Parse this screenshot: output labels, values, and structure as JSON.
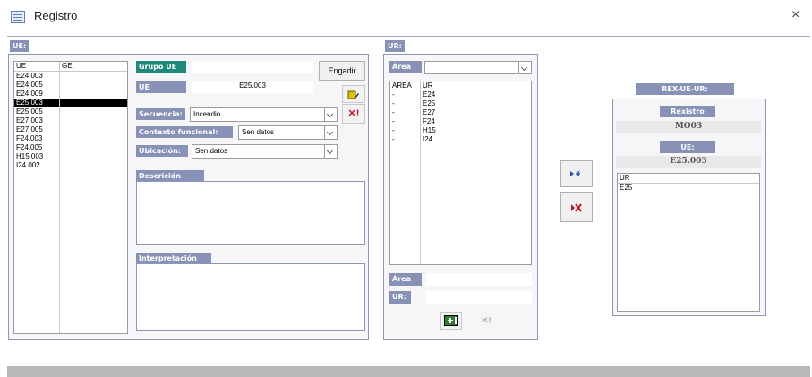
{
  "window": {
    "title": "Registro",
    "close": "×"
  },
  "ue_panel": {
    "header": "UE:",
    "columns": [
      "UE",
      "GE"
    ],
    "rows": [
      "E24.003",
      "E24.005",
      "E24.009",
      "E25.003",
      "E25.005",
      "E27.003",
      "E27.005",
      "F24.003",
      "F24.005",
      "H15.003",
      "I24.002"
    ],
    "selected_index": 3
  },
  "form": {
    "grupo_ue_label": "Grupo UE",
    "grupo_ue_value": "",
    "ue_label": "UE",
    "ue_value": "E25.003",
    "engadir_label": "Engadir",
    "secuencia_label": "Secuencia:",
    "secuencia_value": "Incendio",
    "contexto_label": "Contexto funcional:",
    "contexto_value": "Sen datos",
    "ubicacion_label": "Ubicación:",
    "ubicacion_value": "Sen datos",
    "descricion_label": "Descrición",
    "interpretacion_label": "Interpretación"
  },
  "ur_panel": {
    "header": "UR:",
    "area_label": "Área",
    "area_value": "",
    "columns": [
      "AREA",
      "UR"
    ],
    "rows": [
      [
        "-",
        "E24"
      ],
      [
        "-",
        "E25"
      ],
      [
        "-",
        "E27"
      ],
      [
        "-",
        "F24"
      ],
      [
        "-",
        "H15"
      ],
      [
        "-",
        "I24"
      ]
    ],
    "bottom_area_label": "Área",
    "bottom_ur_label": "UR:"
  },
  "rex_panel": {
    "header": "REX-UE-UR:",
    "rexistro_label": "Rexistro",
    "rexistro_value": "MO03",
    "ue_label": "UE:",
    "ue_value": "E25.003",
    "list_column": "UR",
    "list_rows": [
      "E25"
    ]
  },
  "colors": {
    "accent": "#8891b6",
    "teal": "#1e8a7a",
    "delete": "#c0152a"
  }
}
